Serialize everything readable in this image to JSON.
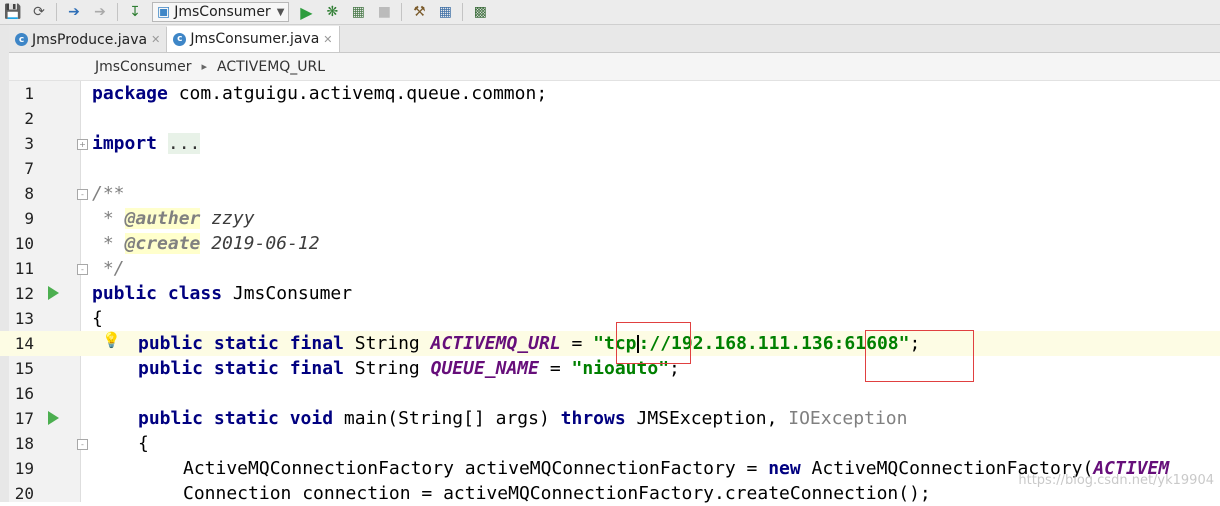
{
  "toolbar": {
    "run_config": "JmsConsumer",
    "icons": [
      "save-icon",
      "sync-icon",
      "back-arrow-icon",
      "forward-arrow-icon",
      "build-icon",
      "run-config-icon",
      "run-icon",
      "debug-icon",
      "coverage-icon",
      "stop-icon",
      "sdk-settings-icon",
      "project-structure-icon",
      "layout-icon"
    ]
  },
  "tabs": [
    {
      "label": "JmsProduce.java",
      "active": false
    },
    {
      "label": "JmsConsumer.java",
      "active": true
    }
  ],
  "breadcrumb": {
    "class": "JmsConsumer",
    "field": "ACTIVEMQ_URL"
  },
  "lines": [
    {
      "n": "1"
    },
    {
      "n": "2"
    },
    {
      "n": "3"
    },
    {
      "n": "7"
    },
    {
      "n": "8"
    },
    {
      "n": "9"
    },
    {
      "n": "10"
    },
    {
      "n": "11"
    },
    {
      "n": "12"
    },
    {
      "n": "13"
    },
    {
      "n": "14"
    },
    {
      "n": "15"
    },
    {
      "n": "16"
    },
    {
      "n": "17"
    },
    {
      "n": "18"
    },
    {
      "n": "19"
    },
    {
      "n": "20"
    }
  ],
  "code": {
    "l1_kw": "package",
    "l1_rest": " com.atguigu.activemq.queue.common;",
    "l3_kw": "import",
    "l3_fold": "...",
    "l8": "/**",
    "l9_star": " * ",
    "l9_tag": "@auther",
    "l9_val": " zzyy",
    "l10_star": " * ",
    "l10_tag": "@create",
    "l10_val": " 2019-06-12",
    "l11": " */",
    "l12_kw": "public class",
    "l12_rest": " JmsConsumer",
    "l13": "{",
    "l14_kw": "public static final",
    "l14_type": " String ",
    "l14_const": "ACTIVEMQ_URL",
    "l14_eq": " = ",
    "l14_str_a": "\"tcp",
    "l14_str_b": "://192.168.111.136:61608\"",
    "l14_end": ";",
    "l15_kw": "public static final",
    "l15_type": " String ",
    "l15_const": "QUEUE_NAME",
    "l15_eq": " = ",
    "l15_str": "\"nioauto\"",
    "l15_end": ";",
    "l17_kw": "public static void",
    "l17_mid": " main(String[] args) ",
    "l17_kw2": "throws",
    "l17_rest": " JMSException, ",
    "l17_gray": "IOException",
    "l18": "{",
    "l19_a": "ActiveMQConnectionFactory activeMQConnectionFactory = ",
    "l19_kw": "new",
    "l19_b": " ActiveMQConnectionFactory(",
    "l19_const": "ACTIVEM",
    "l20": "Connection connection = activeMQConnectionFactory.createConnection();"
  },
  "watermark": "https://blog.csdn.net/yk19904"
}
